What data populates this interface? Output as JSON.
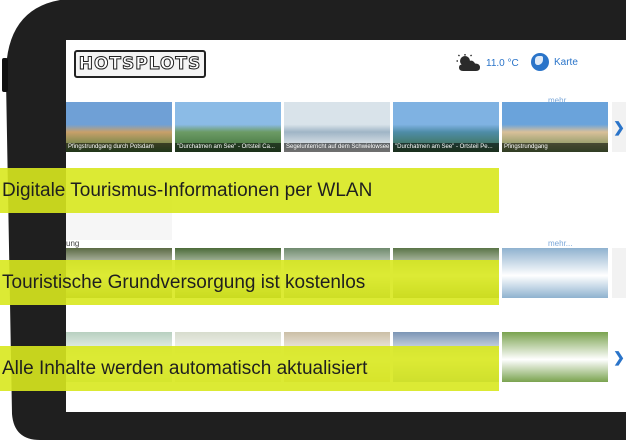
{
  "app": {
    "logo_text": "HOTSPLOTS",
    "weather": {
      "icon": "partly-cloudy-icon",
      "temperature": "11.0 °C"
    },
    "map_link": {
      "icon": "globe-icon",
      "label": "Karte"
    }
  },
  "gallery_1": {
    "more_label": "mehr...",
    "items": [
      {
        "caption": "Pfingstrundgang durch Potsdam",
        "colors": [
          "#6fa0d6",
          "#c8a06a",
          "#4a7a3a"
        ]
      },
      {
        "caption": "\"Durchatmen am See\" - Ortsteil Ca...",
        "colors": [
          "#8bbbe6",
          "#6c9b65",
          "#3d6f3a"
        ]
      },
      {
        "caption": "Segelunterricht auf dem Schwielowsee",
        "colors": [
          "#d9e3ea",
          "#9fb5c6",
          "#f8f8f8"
        ]
      },
      {
        "caption": "\"Durchatmen am See\" - Ortsteil Pe...",
        "colors": [
          "#7fb2e2",
          "#4f8da8",
          "#3b6a3f"
        ]
      },
      {
        "caption": "Pfingstrundgang",
        "colors": [
          "#6aa3db",
          "#d9c09a",
          "#6d8a4f"
        ]
      }
    ]
  },
  "gallery_2": {
    "left_label": "ung",
    "more_label": "mehr...",
    "colors": [
      "#5b6a44",
      "#4c6b39",
      "#6f8a6d",
      "#5a7447",
      "#8fb2cf"
    ]
  },
  "gallery_3": {
    "colors": [
      "#b8d0c0",
      "#d7dccd",
      "#cbbfa6",
      "#7b95b5",
      "#7aa34f"
    ]
  },
  "banners": [
    "Digitale Tourismus-Informationen per WLAN",
    "Touristische Grundversorgung ist kostenlos",
    "Alle Inhalte werden automatisch aktualisiert"
  ],
  "colors": {
    "banner": "#d8e81e",
    "accent": "#2a74c9",
    "bezel": "#1f1f1f"
  }
}
